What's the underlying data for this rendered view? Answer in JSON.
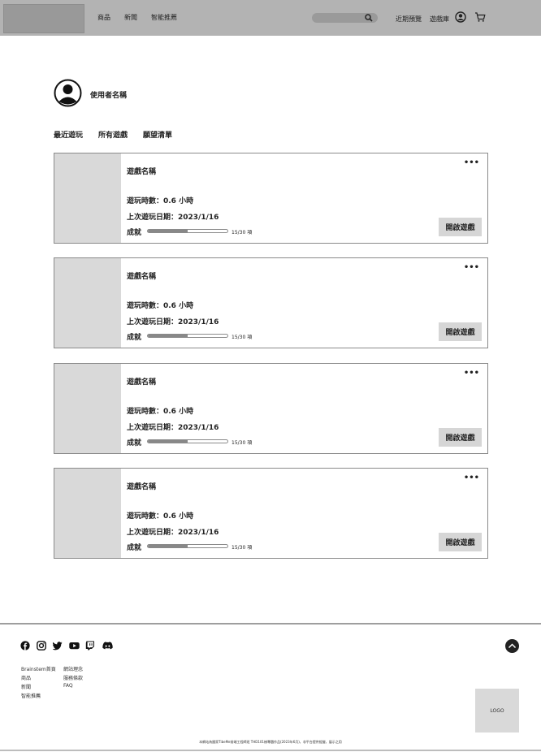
{
  "header": {
    "nav": [
      "商品",
      "新聞",
      "智能推薦"
    ],
    "search_placeholder": "",
    "right_links": [
      "近期預覽",
      "遊戲庫"
    ]
  },
  "profile": {
    "username": "使用者名稱"
  },
  "tabs": [
    "最近遊玩",
    "所有遊戲",
    "願望清單"
  ],
  "cards": [
    {
      "name": "遊戲名稱",
      "hours": "遊玩時數：0.6 小時",
      "last_played": "上次遊玩日期：2023/1/16",
      "achievement_label": "成就",
      "achievement_text": "15/30 項",
      "achievement_progress": 0.5,
      "more": "•••",
      "launch": "開啟遊戲"
    },
    {
      "name": "遊戲名稱",
      "hours": "遊玩時數：0.6 小時",
      "last_played": "上次遊玩日期：2023/1/16",
      "achievement_label": "成就",
      "achievement_text": "15/30 項",
      "achievement_progress": 0.5,
      "more": "•••",
      "launch": "開啟遊戲"
    },
    {
      "name": "遊戲名稱",
      "hours": "遊玩時數：0.6 小時",
      "last_played": "上次遊玩日期：2023/1/16",
      "achievement_label": "成就",
      "achievement_text": "15/30 項",
      "achievement_progress": 0.5,
      "more": "•••",
      "launch": "開啟遊戲"
    },
    {
      "name": "遊戲名稱",
      "hours": "遊玩時數：0.6 小時",
      "last_played": "上次遊玩日期：2023/1/16",
      "achievement_label": "成就",
      "achievement_text": "15/30 項",
      "achievement_progress": 0.5,
      "more": "•••",
      "launch": "開啟遊戲"
    }
  ],
  "footer": {
    "social_icons": [
      "facebook-icon",
      "instagram-icon",
      "twitter-icon",
      "youtube-icon",
      "twitch-icon",
      "discord-icon"
    ],
    "col1": [
      "Brainstem首頁",
      "商品",
      "新聞",
      "智能推薦"
    ],
    "col2": [
      "網站理念",
      "服務條款",
      "FAQ"
    ],
    "logo": "LOGO",
    "copyright": "本網站為國家TibeMe前端工程師班 THD101梯專題作品(2023年6月)，非平台提供經營，展示之用"
  },
  "colors": {
    "header_bg": "#b3b3b3",
    "thumb_bg": "#d9d9d9",
    "button_bg": "#d6d6d6",
    "progress_fill": "#888888"
  }
}
